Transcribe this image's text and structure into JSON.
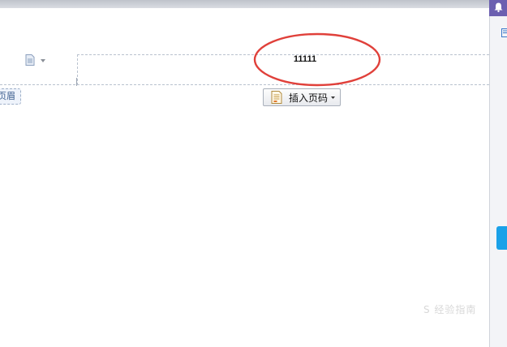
{
  "header": {
    "content_text": "11111",
    "tag_label": "页眉"
  },
  "toolbar": {
    "insert_page_number_label": "插入页码"
  },
  "watermark": {
    "text": "S 经验指南"
  },
  "icons": {
    "doc": "document-icon",
    "dropdown": "chevron-down-icon",
    "insert": "page-number-icon",
    "bell": "bell-icon",
    "panel": "panel-icon"
  },
  "colors": {
    "annotation_red": "#e0403a",
    "panel_purple": "#6b5fb0",
    "panel_blue": "#1aa1e8",
    "header_border": "#b9c2cf"
  }
}
